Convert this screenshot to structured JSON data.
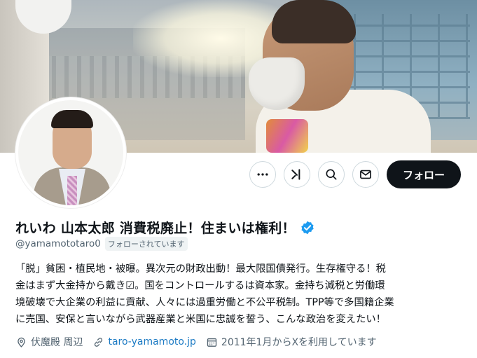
{
  "profile": {
    "display_name": "れいわ 山本太郎 消費税廃止！住まいは権利！",
    "handle": "@yamamototaro0",
    "follows_you_badge": "フォローされています",
    "bio_lines": [
      "「脱」貧困・植民地・被曝。異次元の財政出動！最大限国債発行。生存権守る！税",
      "金はまず大金持から戴き☑。国をコントロールするは資本家。金持ち減税と労働環",
      "境破壊で大企業の利益に貢献、人々には過重労働と不公平税制。TPP等で多国籍企業",
      "に売国、安保と言いながら武器産業と米国に忠誠を誓う、こんな政治を変えたい！"
    ],
    "location": "伏魔殿 周辺",
    "website": "taro-yamamoto.jp",
    "joined": "2011年1月からXを利用しています"
  },
  "actions": {
    "follow_label": "フォロー",
    "icons": [
      "more-icon",
      "grok-icon",
      "search-icon",
      "message-icon"
    ]
  },
  "colors": {
    "verified": "#1d9bf0",
    "follow_bg": "#0f1419",
    "link": "#1d7bc4",
    "secondary_text": "#536471"
  }
}
